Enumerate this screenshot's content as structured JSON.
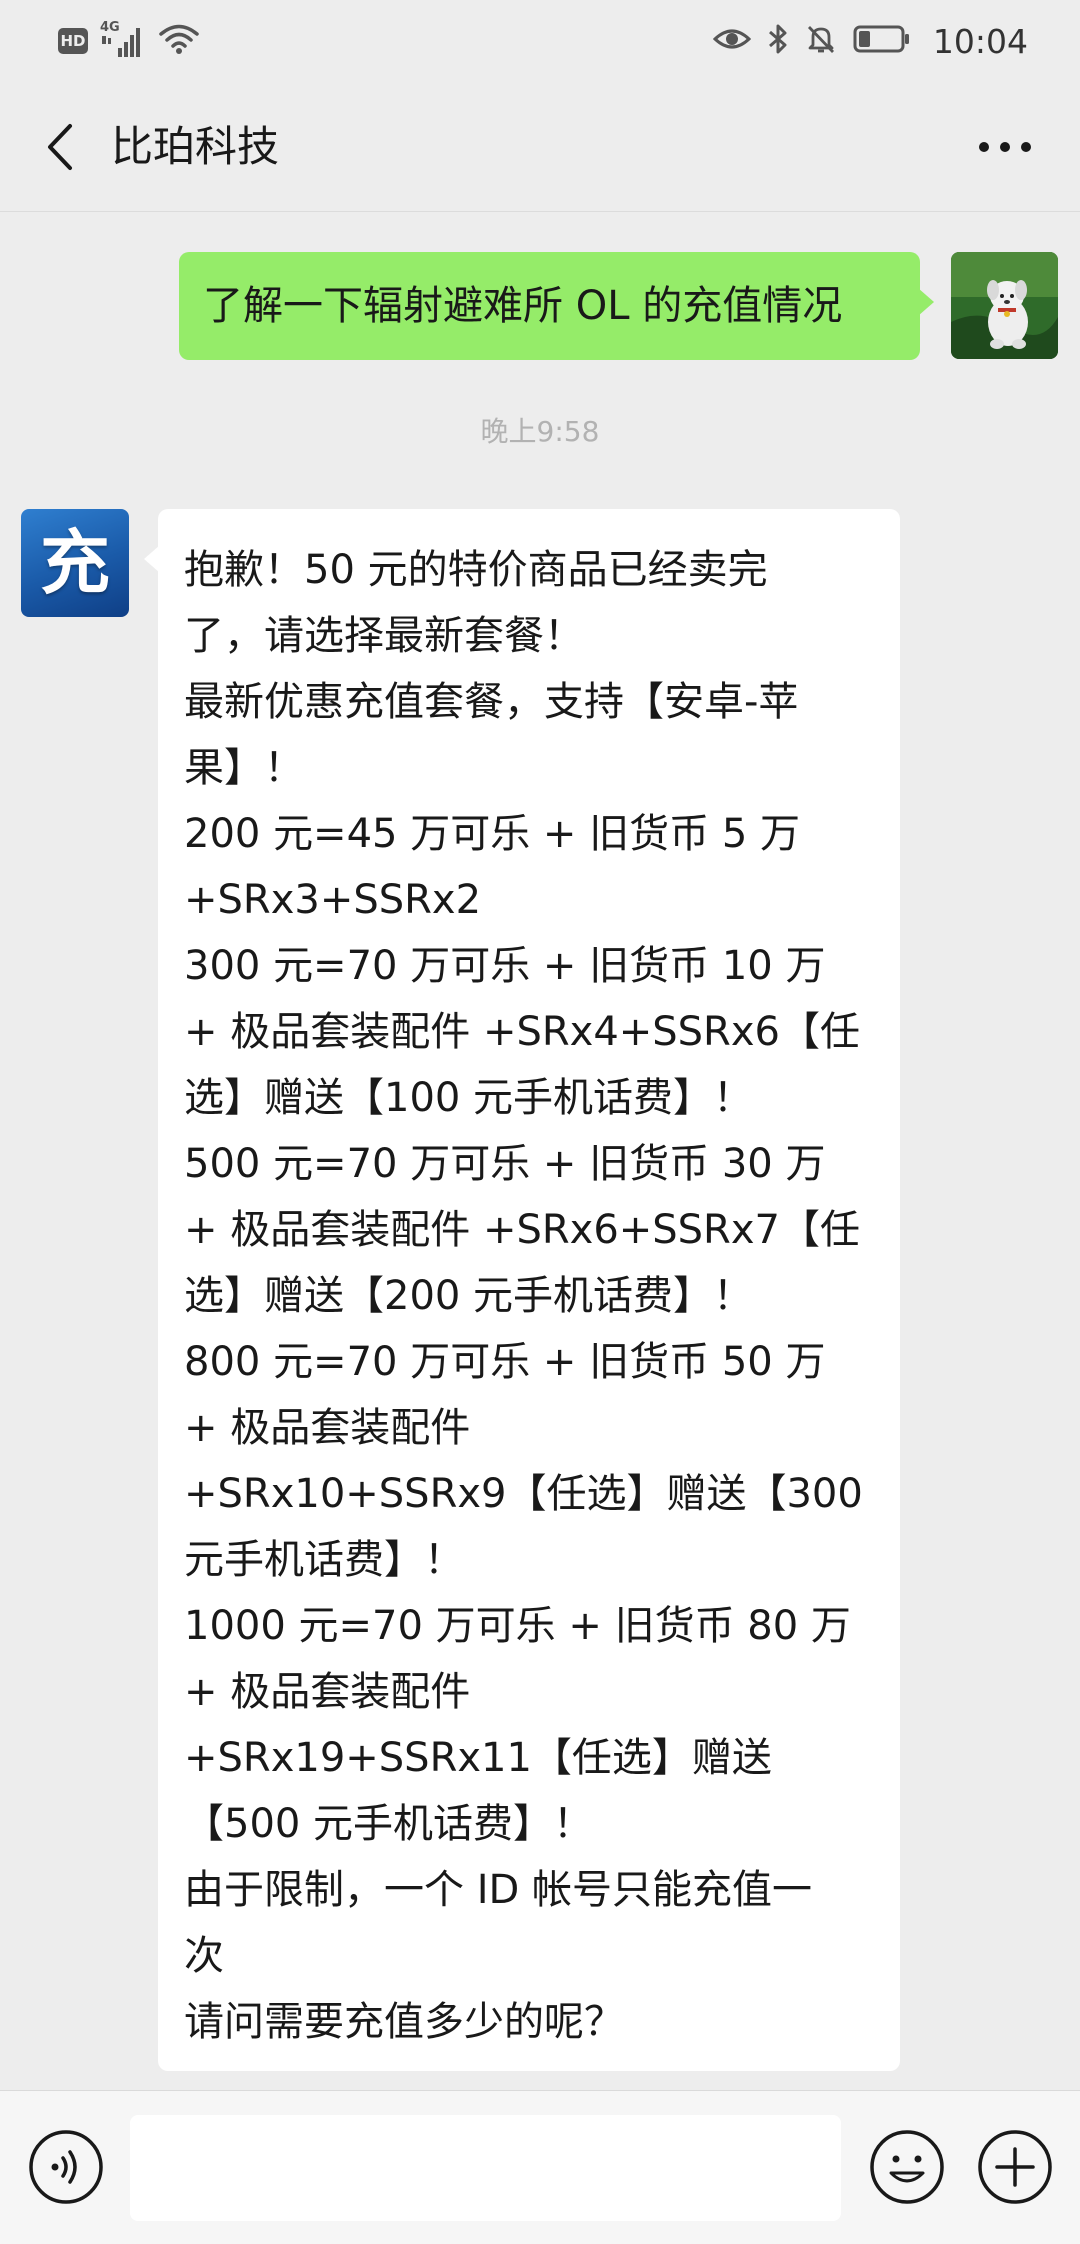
{
  "status_bar": {
    "hd": "HD",
    "network": "4G",
    "time": "10:04"
  },
  "header": {
    "title": "比珀科技",
    "back_icon": "chevron-left-icon",
    "more_icon": "more-dots-icon"
  },
  "messages": {
    "sent": {
      "text": "了解一下辐射避难所 OL 的充值情况",
      "avatar": "cartoon-dog-avatar"
    },
    "timestamp": "晚上9:58",
    "received": {
      "avatar_text": "充",
      "lines": [
        "抱歉！50 元的特价商品已经卖完",
        "了，请选择最新套餐！",
        "最新优惠充值套餐，支持【安卓-苹",
        "果】！",
        "200 元=45 万可乐 + 旧货币 5 万",
        "+SRx3+SSRx2",
        "300 元=70 万可乐 + 旧货币 10 万",
        "+ 极品套装配件 +SRx4+SSRx6【任",
        "选】赠送【100 元手机话费】！",
        "500 元=70 万可乐 + 旧货币 30 万",
        "+ 极品套装配件 +SRx6+SSRx7【任",
        "选】赠送【200 元手机话费】！",
        "800 元=70 万可乐 + 旧货币 50 万",
        "+ 极品套装配件",
        "+SRx10+SSRx9【任选】赠送【300",
        "元手机话费】！",
        "1000 元=70 万可乐 + 旧货币 80 万",
        "+ 极品套装配件",
        "+SRx19+SSRx11【任选】赠送",
        "【500 元手机话费】！",
        "由于限制，一个 ID 帐号只能充值一",
        "次",
        "请问需要充值多少的呢？"
      ]
    }
  },
  "input_bar": {
    "voice_icon": "voice-icon",
    "input_value": "",
    "emoji_icon": "emoji-icon",
    "plus_icon": "plus-icon"
  },
  "colors": {
    "background": "#ededed",
    "sent_bubble": "#95ec69",
    "received_bubble": "#ffffff",
    "timestamp": "#b2b2b2"
  }
}
